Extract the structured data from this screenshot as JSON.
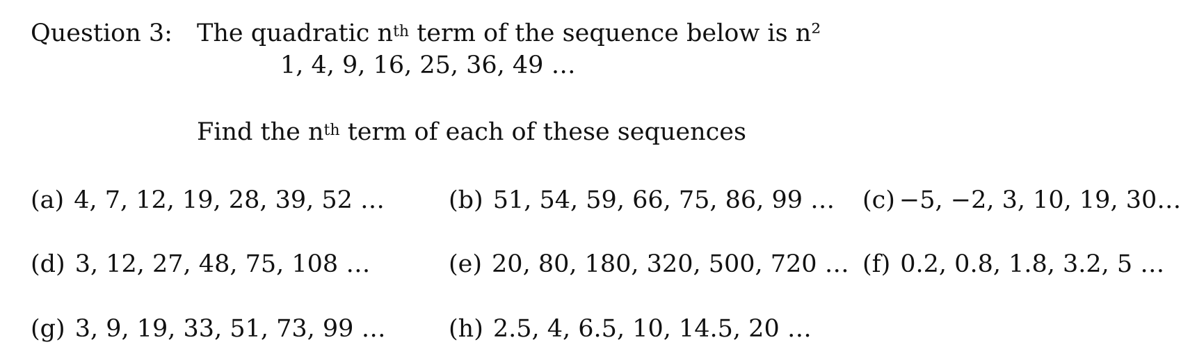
{
  "question": {
    "label": "Question 3:",
    "intro_before": "The quadratic n",
    "intro_sup": "th",
    "intro_after": " term of the sequence below is  n²",
    "example_sequence": "1, 4, 9, 16, 25, 36, 49 …",
    "prompt_before": "Find the n",
    "prompt_sup": "th",
    "prompt_after": " term of each of these sequences"
  },
  "parts": [
    {
      "label": "(a)",
      "sequence": "4, 7, 12, 19, 28, 39, 52 …"
    },
    {
      "label": "(b)",
      "sequence": "51, 54, 59, 66, 75, 86, 99 …"
    },
    {
      "label": "(c)",
      "sequence": "−5, −2, 3, 10, 19, 30…"
    },
    {
      "label": "(d)",
      "sequence": "3, 12, 27, 48, 75, 108 …"
    },
    {
      "label": "(e)",
      "sequence": "20, 80, 180, 320, 500, 720 …"
    },
    {
      "label": "(f)",
      "sequence": "0.2, 0.8, 1.8, 3.2, 5 …"
    },
    {
      "label": "(g)",
      "sequence": "3, 9, 19, 33, 51, 73, 99 …"
    },
    {
      "label": "(h)",
      "sequence": "2.5, 4, 6.5, 10, 14.5, 20 …"
    }
  ]
}
